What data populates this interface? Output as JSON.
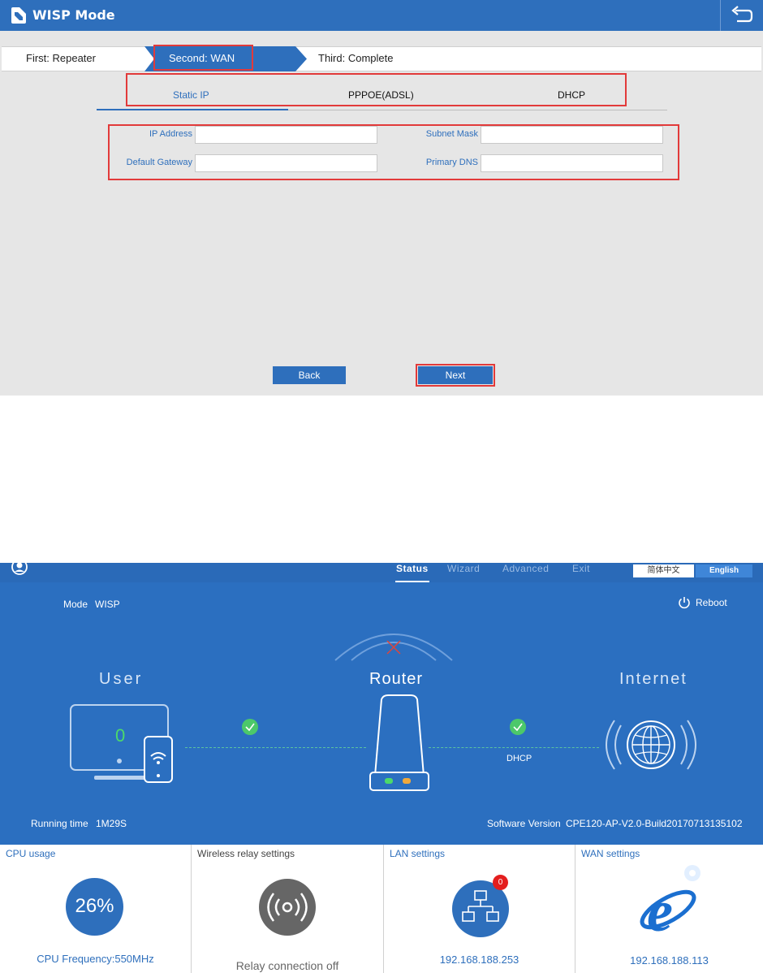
{
  "wizard": {
    "title": "WISP Mode",
    "steps": {
      "first": "First: Repeater",
      "second": "Second: WAN",
      "third": "Third: Complete"
    },
    "tabs": [
      "Static IP",
      "PPPOE(ADSL)",
      "DHCP"
    ],
    "fields": {
      "ip_address": {
        "label": "IP Address",
        "value": ""
      },
      "subnet_mask": {
        "label": "Subnet Mask",
        "value": ""
      },
      "default_gateway": {
        "label": "Default Gateway",
        "value": ""
      },
      "primary_dns": {
        "label": "Primary DNS",
        "value": ""
      }
    },
    "buttons": {
      "back": "Back",
      "next": "Next"
    },
    "colors": {
      "accent": "#2e6fbc",
      "highlight": "#e23a3a"
    }
  },
  "dashboard": {
    "nav": {
      "items": [
        "Status",
        "Wizard",
        "Advanced",
        "Exit"
      ],
      "active": "Status",
      "lang_cn": "简体中文",
      "lang_en": "English"
    },
    "mode_label": "Mode",
    "mode_value": "WISP",
    "reboot": "Reboot",
    "user_label": "User",
    "router_label": "Router",
    "internet_label": "Internet",
    "user_count": "0",
    "wan_type": "DHCP",
    "running_time_label": "Running time",
    "running_time": "1M29S",
    "software_version_label": "Software Version",
    "software_version": "CPE120-AP-V2.0-Build20170713135102",
    "tiles": {
      "cpu": {
        "title": "CPU usage",
        "value": "26%",
        "footer": "CPU Frequency:550MHz"
      },
      "relay": {
        "title": "Wireless relay settings",
        "footer": "Relay connection off"
      },
      "lan": {
        "title": "LAN settings",
        "badge": "0",
        "footer": "192.168.188.253"
      },
      "wan": {
        "title": "WAN settings",
        "footer": "192.168.188.113"
      }
    },
    "colors": {
      "status_bg": "#2b6fc0",
      "ok_green": "#4cc86a",
      "badge_red": "#e41e1e"
    }
  }
}
